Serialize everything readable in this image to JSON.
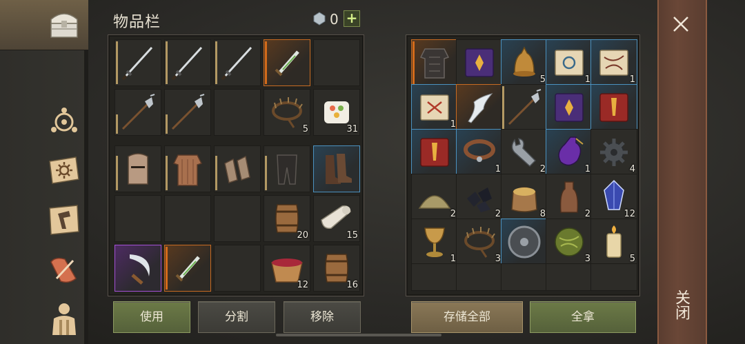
{
  "header": {
    "title": "物品栏",
    "currency": "0",
    "add_label": "+"
  },
  "nav": [
    "chest-icon",
    "rune-icon",
    "sun-book-icon",
    "hammer-map-icon",
    "scroll-quill-icon",
    "character-icon"
  ],
  "inventory": {
    "quantities": {
      "trap": "5",
      "food": "31",
      "barrel1": "20",
      "cloth": "15",
      "bowl": "12",
      "barrel2": "16"
    }
  },
  "storage": {
    "quantities": {
      "bell": "5",
      "scroll1": "1",
      "scroll2": "1",
      "scroll3": "1",
      "collar": "1",
      "wrench": "2",
      "potion": "1",
      "gear": "4",
      "sand": "2",
      "coal": "2",
      "sack": "8",
      "bottle": "2",
      "crystal": "12",
      "goblet": "1",
      "trap": "3",
      "meat": "3",
      "candle": "5"
    }
  },
  "buttons": {
    "use": "使用",
    "split": "分割",
    "remove": "移除",
    "store_all": "存储全部",
    "take_all": "全拿"
  },
  "close": {
    "label": "关闭"
  },
  "colors": {
    "rarity_orange": "#c86b22",
    "rarity_blue": "#4b92c0",
    "rarity_purple": "#a451d6",
    "accent_green": "#6c7a47"
  }
}
